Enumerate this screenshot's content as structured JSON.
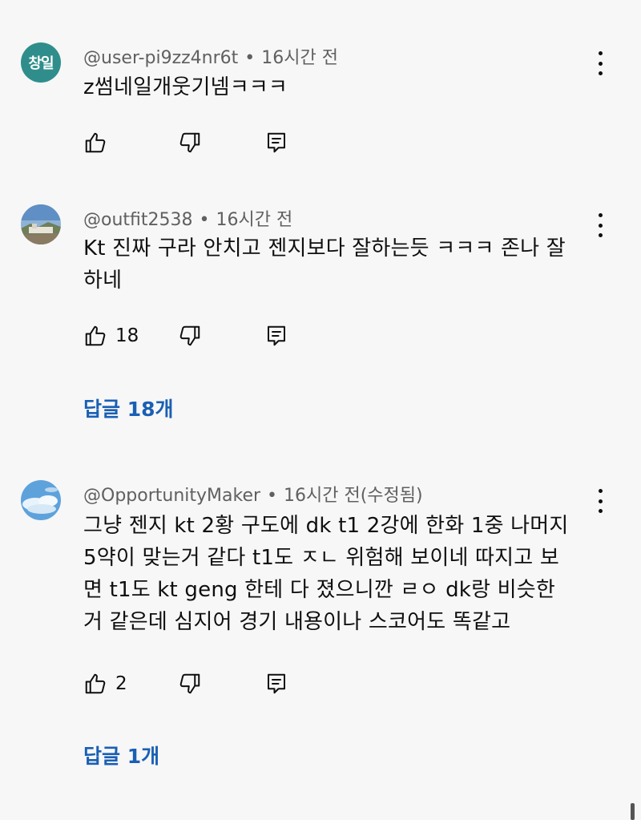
{
  "comments": [
    {
      "author": "@user-pi9zz4nr6t",
      "time": "16시간 전",
      "avatar_text": "창일",
      "text": "z썸네일개웃기넴ㅋㅋㅋ",
      "likes": "",
      "replies": ""
    },
    {
      "author": "@outfit2538",
      "time": "16시간 전",
      "avatar_icon": "landscape-photo-avatar",
      "text_lines": [
        "Kt 진짜 구라 안치고 젠지보다 잘하는듯 ㅋㅋㅋ 존나 잘",
        "하네"
      ],
      "likes": "18",
      "replies": "답글 18개"
    },
    {
      "author": "@OpportunityMaker",
      "time": "16시간 전(수정됨)",
      "avatar_icon": "sky-photo-avatar",
      "text_lines": [
        "그냥 젠지 kt 2황 구도에 dk t1 2강에 한화 1중 나머지",
        "5약이 맞는거 같다 t1도 ㅈㄴ 위험해 보이네 따지고 보",
        "면 t1도 kt geng 한테 다 졌으니깐 ㄹㅇ dk랑 비슷한",
        "거 같은데 심지어 경기 내용이나 스코어도 똑같고"
      ],
      "likes": "2",
      "replies": "답글 1개"
    }
  ],
  "separator": "•",
  "icons": {
    "like": "thumbs-up-icon",
    "dislike": "thumbs-down-icon",
    "reply": "reply-comment-icon",
    "more": "more-vertical-icon"
  },
  "colors": {
    "reply_link": "#1a5fb4",
    "avatar_teal": "#2f8e8b"
  }
}
